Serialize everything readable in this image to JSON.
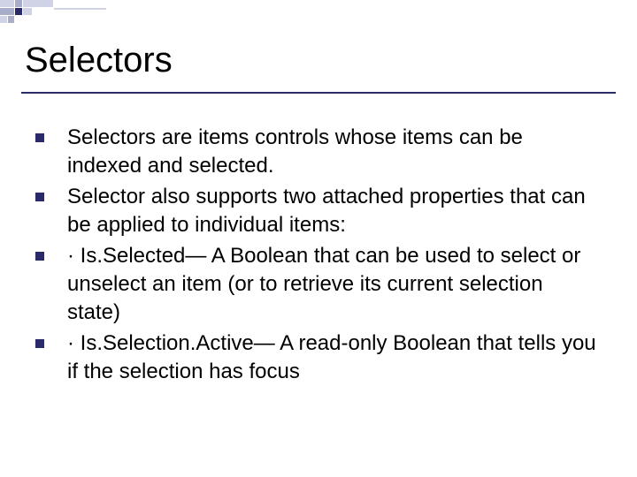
{
  "title": "Selectors",
  "bullets": [
    "Selectors are items controls whose items can be indexed and selected.",
    "Selector also supports two attached properties that can be applied to individual items:",
    "· Is.Selected— A Boolean that can be used to select or unselect an item (or to retrieve its current selection state)",
    "· Is.Selection.Active— A read-only Boolean that tells you if the selection has focus"
  ],
  "colors": {
    "accent": "#2a2a6a",
    "light1": "#d0d3e6",
    "light2": "#a8adc9"
  }
}
